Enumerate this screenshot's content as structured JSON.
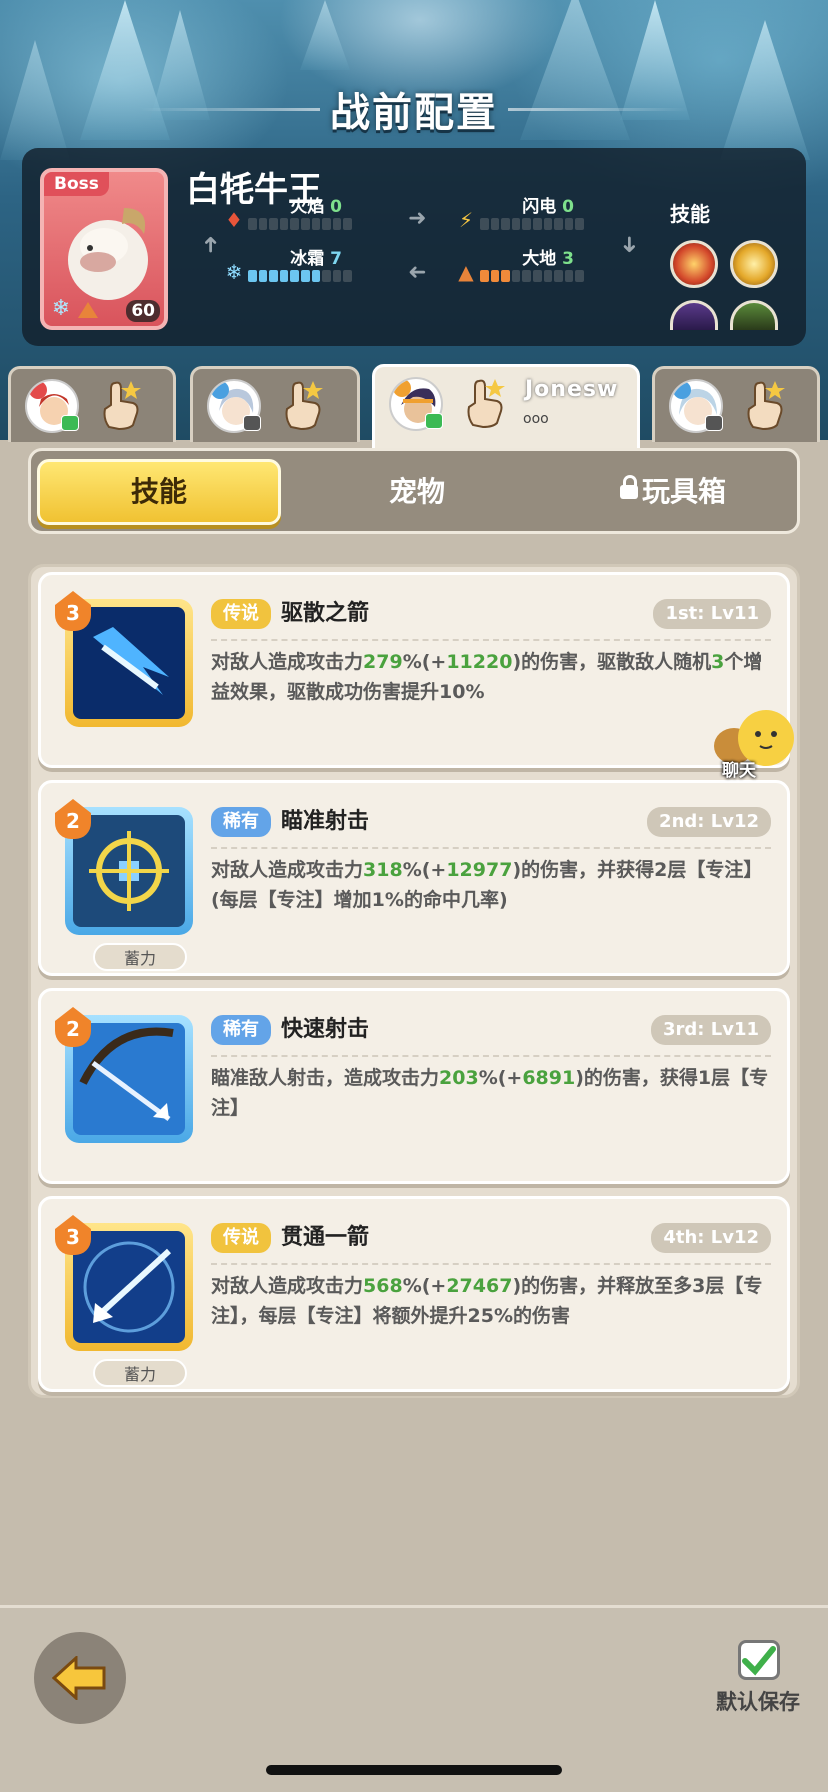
{
  "header": {
    "title": "战前配置"
  },
  "boss": {
    "tag": "Boss",
    "name": "白牦牛王",
    "level": "60",
    "element": "frost",
    "stats": [
      {
        "name": "火焰",
        "value": "0",
        "level": 0
      },
      {
        "name": "闪电",
        "value": "0",
        "level": 0
      },
      {
        "name": "冰霜",
        "value": "7",
        "level": 7
      },
      {
        "name": "大地",
        "value": "3",
        "level": 3
      }
    ],
    "skills_label": "技能",
    "skill_icons": [
      "fire-orb-icon",
      "golden-claw-icon",
      "dark-mage-icon",
      "green-beast-icon"
    ]
  },
  "characters": [
    {
      "name": "",
      "active": false
    },
    {
      "name": "",
      "active": false
    },
    {
      "name": "Jonesw",
      "sub": "ooo",
      "active": true
    },
    {
      "name": "",
      "active": false
    }
  ],
  "tabs": [
    {
      "label": "技能",
      "active": true
    },
    {
      "label": "宠物",
      "active": false
    },
    {
      "label": "玩具箱",
      "locked": true,
      "active": false
    }
  ],
  "skills": [
    {
      "level": "3",
      "rarity": "传说",
      "name": "驱散之箭",
      "slot": "1st: Lv11",
      "desc_pre": "对敌人造成攻击力",
      "pct": "279",
      "desc_mid1": "%(+",
      "bonus": "11220",
      "desc_mid2": ")的伤害，驱散敌人随机",
      "count": "3",
      "desc_post": "个增益效果，驱散成功伤害提升10%",
      "charge": ""
    },
    {
      "level": "2",
      "rarity": "稀有",
      "name": "瞄准射击",
      "slot": "2nd: Lv12",
      "desc_pre": "对敌人造成攻击力",
      "pct": "318",
      "desc_mid1": "%(+",
      "bonus": "12977",
      "desc_mid2": ")的伤害，并获得2层【专注】(每层【专注】增加1%的命中几率)",
      "count": "",
      "desc_post": "",
      "charge": "蓄力"
    },
    {
      "level": "2",
      "rarity": "稀有",
      "name": "快速射击",
      "slot": "3rd: Lv11",
      "desc_pre": "瞄准敌人射击，造成攻击力",
      "pct": "203",
      "desc_mid1": "%(+",
      "bonus": "6891",
      "desc_mid2": ")的伤害，获得1层【专注】",
      "count": "",
      "desc_post": "",
      "charge": ""
    },
    {
      "level": "3",
      "rarity": "传说",
      "name": "贯通一箭",
      "slot": "4th: Lv12",
      "desc_pre": "对敌人造成攻击力",
      "pct": "568",
      "desc_mid1": "%(+",
      "bonus": "27467",
      "desc_mid2": ")的伤害，并释放至多3层【专注】，每层【专注】将额外提升25%的伤害",
      "count": "",
      "desc_post": "",
      "charge": "蓄力"
    }
  ],
  "chat": {
    "label": "聊天"
  },
  "footer": {
    "save_label": "默认保存"
  },
  "colors": {
    "gold": "#f1c33e",
    "blue": "#63a4e8",
    "highlight": "#4aa23e"
  }
}
